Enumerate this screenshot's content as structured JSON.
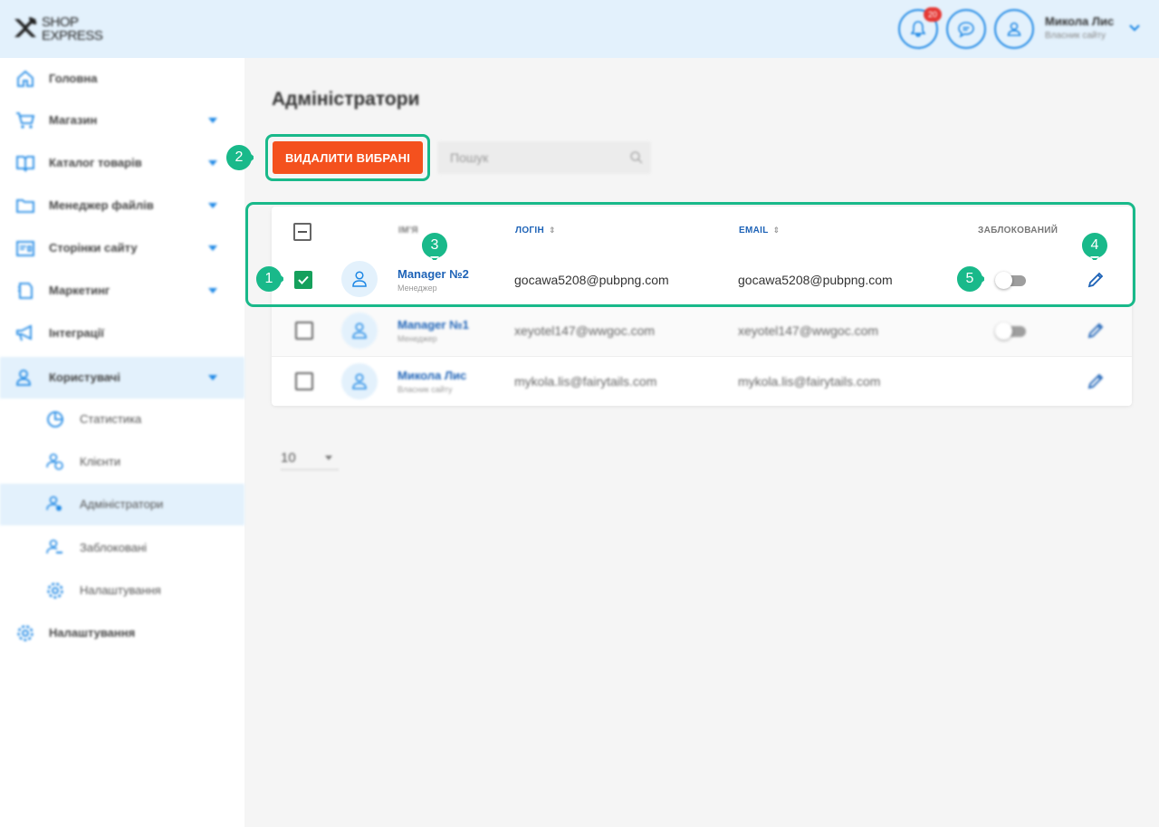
{
  "header": {
    "logo_line1": "SHOP",
    "logo_line2": "EXPRESS",
    "notif_count": "20",
    "user_name": "Микола Лис",
    "user_role": "Власник сайту"
  },
  "sidebar": {
    "items": [
      {
        "label": "Головна",
        "icon": "home-icon"
      },
      {
        "label": "Магазин",
        "icon": "cart-icon"
      },
      {
        "label": "Каталог товарів",
        "icon": "catalog-icon"
      },
      {
        "label": "Менеджер файлів",
        "icon": "folder-icon"
      },
      {
        "label": "Сторінки сайту",
        "icon": "pages-icon"
      },
      {
        "label": "Маркетинг",
        "icon": "marketing-icon"
      },
      {
        "label": "Інтеграції",
        "icon": "megaphone-icon"
      },
      {
        "label": "Користувачі",
        "icon": "users-icon"
      }
    ],
    "subitems": [
      {
        "label": "Статистика",
        "icon": "chart-icon"
      },
      {
        "label": "Клієнти",
        "icon": "clients-icon"
      },
      {
        "label": "Адміністратори",
        "icon": "admins-icon"
      },
      {
        "label": "Заблоковані",
        "icon": "blocked-icon"
      },
      {
        "label": "Налаштування",
        "icon": "gear-icon"
      }
    ],
    "settings": {
      "label": "Налаштування",
      "icon": "gear-icon"
    }
  },
  "main": {
    "title": "Адміністратори",
    "delete_button": "ВИДАЛИТИ ВИБРАНІ",
    "search_placeholder": "Пошук",
    "columns": {
      "name": "ІМ'Я",
      "login": "ЛОГІН",
      "email": "EMAIL",
      "blocked": "ЗАБЛОКОВАНИЙ"
    },
    "rows": [
      {
        "name": "Manager №2",
        "role": "Менеджер",
        "login": "gocawa5208@pubpng.com",
        "email": "gocawa5208@pubpng.com",
        "checked": true,
        "blocked": false
      },
      {
        "name": "Manager №1",
        "role": "Менеджер",
        "login": "xeyotel147@wwgoc.com",
        "email": "xeyotel147@wwgoc.com",
        "checked": false,
        "blocked": false
      },
      {
        "name": "Микола Лис",
        "role": "Власник сайту",
        "login": "mykola.lis@fairytails.com",
        "email": "mykola.lis@fairytails.com",
        "checked": false,
        "blocked": false
      }
    ],
    "per_page": "10"
  },
  "markers": [
    "1",
    "2",
    "3",
    "4",
    "5"
  ],
  "colors": {
    "accent": "#1e88e5",
    "danger": "#f4511e",
    "highlight": "#19b98a",
    "check": "#16a05c"
  }
}
